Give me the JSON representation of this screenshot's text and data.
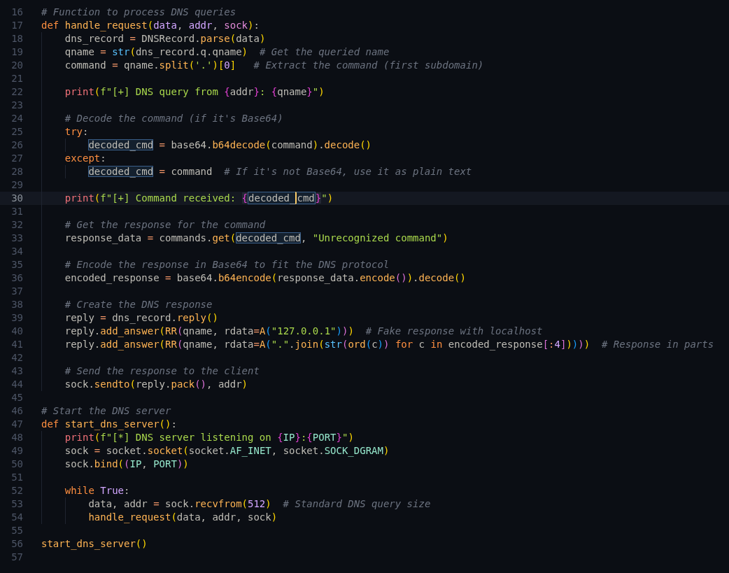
{
  "editor": {
    "lines": [
      {
        "number": "16",
        "current": false,
        "tokens": [
          {
            "text": "# Function to process DNS queries",
            "kind": "comment"
          }
        ]
      },
      {
        "number": "17",
        "current": false,
        "tokens": [
          {
            "text": "def",
            "kind": "kw"
          },
          {
            "text": " handle_request",
            "kind": "fn"
          },
          {
            "text": "(",
            "kind": "p1"
          },
          {
            "text": "data",
            "kind": "param"
          },
          {
            "text": ", ",
            "kind": "punct"
          },
          {
            "text": "addr",
            "kind": "param"
          },
          {
            "text": ", ",
            "kind": "punct"
          },
          {
            "text": "sock",
            "kind": "param2"
          },
          {
            "text": ")",
            "kind": "p1"
          },
          {
            "text": ":",
            "kind": "punct"
          }
        ]
      },
      {
        "number": "18",
        "current": false,
        "tokens": [
          {
            "text": "    dns_record ",
            "kind": "plain"
          },
          {
            "text": "=",
            "kind": "op"
          },
          {
            "text": " DNSRecord.",
            "kind": "plain"
          },
          {
            "text": "parse",
            "kind": "fn"
          },
          {
            "text": "(",
            "kind": "p1"
          },
          {
            "text": "data",
            "kind": "plain"
          },
          {
            "text": ")",
            "kind": "p1"
          }
        ]
      },
      {
        "number": "19",
        "current": false,
        "tokens": [
          {
            "text": "    qname ",
            "kind": "plain"
          },
          {
            "text": "=",
            "kind": "op"
          },
          {
            "text": " str",
            "kind": "builtin"
          },
          {
            "text": "(",
            "kind": "p1"
          },
          {
            "text": "dns_record.q.qname",
            "kind": "plain"
          },
          {
            "text": ")",
            "kind": "p1"
          },
          {
            "text": "  # Get the queried name",
            "kind": "comment"
          }
        ]
      },
      {
        "number": "20",
        "current": false,
        "tokens": [
          {
            "text": "    command ",
            "kind": "plain"
          },
          {
            "text": "=",
            "kind": "op"
          },
          {
            "text": " qname.",
            "kind": "plain"
          },
          {
            "text": "split",
            "kind": "fn"
          },
          {
            "text": "(",
            "kind": "p1"
          },
          {
            "text": "'.'",
            "kind": "str"
          },
          {
            "text": ")",
            "kind": "p1"
          },
          {
            "text": "[",
            "kind": "p1"
          },
          {
            "text": "0",
            "kind": "num"
          },
          {
            "text": "]",
            "kind": "p1"
          },
          {
            "text": "   # Extract the command (first subdomain)",
            "kind": "comment"
          }
        ]
      },
      {
        "number": "21",
        "current": false
      },
      {
        "number": "22",
        "current": false,
        "tokens": [
          {
            "text": "    print",
            "kind": "call"
          },
          {
            "text": "(",
            "kind": "p1"
          },
          {
            "text": "f\"[+] DNS query from ",
            "kind": "str"
          },
          {
            "text": "{",
            "kind": "brace"
          },
          {
            "text": "addr",
            "kind": "plain"
          },
          {
            "text": "}",
            "kind": "brace"
          },
          {
            "text": ": ",
            "kind": "str"
          },
          {
            "text": "{",
            "kind": "brace"
          },
          {
            "text": "qname",
            "kind": "plain"
          },
          {
            "text": "}",
            "kind": "brace"
          },
          {
            "text": "\"",
            "kind": "str"
          },
          {
            "text": ")",
            "kind": "p1"
          }
        ]
      },
      {
        "number": "23",
        "current": false
      },
      {
        "number": "24",
        "current": false,
        "tokens": [
          {
            "text": "    # Decode the command (if it's Base64)",
            "kind": "comment"
          }
        ]
      },
      {
        "number": "25",
        "current": false,
        "tokens": [
          {
            "text": "    try",
            "kind": "kw"
          },
          {
            "text": ":",
            "kind": "punct"
          }
        ]
      },
      {
        "number": "26",
        "current": false,
        "tokens": [
          {
            "text": "        decoded_cmd",
            "kind": "match"
          },
          {
            "text": " =",
            "kind": "op"
          },
          {
            "text": " base64.",
            "kind": "plain"
          },
          {
            "text": "b64decode",
            "kind": "fn"
          },
          {
            "text": "(",
            "kind": "p1"
          },
          {
            "text": "command",
            "kind": "plain"
          },
          {
            "text": ")",
            "kind": "p1"
          },
          {
            "text": ".",
            "kind": "plain"
          },
          {
            "text": "decode",
            "kind": "fn"
          },
          {
            "text": "()",
            "kind": "p1"
          }
        ]
      },
      {
        "number": "27",
        "current": false,
        "tokens": [
          {
            "text": "    except",
            "kind": "kw"
          },
          {
            "text": ":",
            "kind": "punct"
          }
        ]
      },
      {
        "number": "28",
        "current": false,
        "tokens": [
          {
            "text": "        decoded_cmd",
            "kind": "match"
          },
          {
            "text": " =",
            "kind": "op"
          },
          {
            "text": " command",
            "kind": "plain"
          },
          {
            "text": "  # If it's not Base64, use it as plain text",
            "kind": "comment"
          }
        ]
      },
      {
        "number": "29",
        "current": false
      },
      {
        "number": "30",
        "current": true,
        "tokens": [
          {
            "text": "    print",
            "kind": "call"
          },
          {
            "text": "(",
            "kind": "p1"
          },
          {
            "text": "f\"[+] Command received: ",
            "kind": "str"
          },
          {
            "text": "{",
            "kind": "brace-pair"
          },
          {
            "text": "decoded_",
            "kind": "match-left"
          },
          {
            "text": "cmd",
            "kind": "match-right-caret"
          },
          {
            "text": "}",
            "kind": "brace-pair"
          },
          {
            "text": "\"",
            "kind": "str"
          },
          {
            "text": ")",
            "kind": "p1"
          }
        ]
      },
      {
        "number": "31",
        "current": false
      },
      {
        "number": "32",
        "current": false,
        "tokens": [
          {
            "text": "    # Get the response for the command",
            "kind": "comment"
          }
        ]
      },
      {
        "number": "33",
        "current": false,
        "tokens": [
          {
            "text": "    response_data ",
            "kind": "plain"
          },
          {
            "text": "=",
            "kind": "op"
          },
          {
            "text": " commands.",
            "kind": "plain"
          },
          {
            "text": "get",
            "kind": "fn"
          },
          {
            "text": "(",
            "kind": "p1"
          },
          {
            "text": "decoded_cmd",
            "kind": "match"
          },
          {
            "text": ", ",
            "kind": "punct"
          },
          {
            "text": "\"Unrecognized command\"",
            "kind": "str"
          },
          {
            "text": ")",
            "kind": "p1"
          }
        ]
      },
      {
        "number": "34",
        "current": false
      },
      {
        "number": "35",
        "current": false,
        "tokens": [
          {
            "text": "    # Encode the response in Base64 to fit the DNS protocol",
            "kind": "comment"
          }
        ]
      },
      {
        "number": "36",
        "current": false,
        "tokens": [
          {
            "text": "    encoded_response ",
            "kind": "plain"
          },
          {
            "text": "=",
            "kind": "op"
          },
          {
            "text": " base64.",
            "kind": "plain"
          },
          {
            "text": "b64encode",
            "kind": "fn"
          },
          {
            "text": "(",
            "kind": "p1"
          },
          {
            "text": "response_data.",
            "kind": "plain"
          },
          {
            "text": "encode",
            "kind": "fn"
          },
          {
            "text": "()",
            "kind": "p2"
          },
          {
            "text": ")",
            "kind": "p1"
          },
          {
            "text": ".",
            "kind": "plain"
          },
          {
            "text": "decode",
            "kind": "fn"
          },
          {
            "text": "()",
            "kind": "p1"
          }
        ]
      },
      {
        "number": "37",
        "current": false
      },
      {
        "number": "38",
        "current": false,
        "tokens": [
          {
            "text": "    # Create the DNS response",
            "kind": "comment"
          }
        ]
      },
      {
        "number": "39",
        "current": false,
        "tokens": [
          {
            "text": "    reply ",
            "kind": "plain"
          },
          {
            "text": "=",
            "kind": "op"
          },
          {
            "text": " dns_record.",
            "kind": "plain"
          },
          {
            "text": "reply",
            "kind": "fn"
          },
          {
            "text": "()",
            "kind": "p1"
          }
        ]
      },
      {
        "number": "40",
        "current": false,
        "tokens": [
          {
            "text": "    reply.",
            "kind": "plain"
          },
          {
            "text": "add_answer",
            "kind": "fn"
          },
          {
            "text": "(",
            "kind": "p1"
          },
          {
            "text": "RR",
            "kind": "fn"
          },
          {
            "text": "(",
            "kind": "p2"
          },
          {
            "text": "qname, rdata",
            "kind": "plain"
          },
          {
            "text": "=",
            "kind": "op"
          },
          {
            "text": "A",
            "kind": "fn"
          },
          {
            "text": "(",
            "kind": "p3"
          },
          {
            "text": "\"127.0.0.1\"",
            "kind": "str"
          },
          {
            "text": ")",
            "kind": "p3"
          },
          {
            "text": ")",
            "kind": "p2"
          },
          {
            "text": ")",
            "kind": "p1"
          },
          {
            "text": "  # Fake response with localhost",
            "kind": "comment"
          }
        ]
      },
      {
        "number": "41",
        "current": false,
        "tokens": [
          {
            "text": "    reply.",
            "kind": "plain"
          },
          {
            "text": "add_answer",
            "kind": "fn"
          },
          {
            "text": "(",
            "kind": "p1"
          },
          {
            "text": "RR",
            "kind": "fn"
          },
          {
            "text": "(",
            "kind": "p2"
          },
          {
            "text": "qname, rdata",
            "kind": "plain"
          },
          {
            "text": "=",
            "kind": "op"
          },
          {
            "text": "A",
            "kind": "fn"
          },
          {
            "text": "(",
            "kind": "p3"
          },
          {
            "text": "\".\"",
            "kind": "str"
          },
          {
            "text": ".",
            "kind": "plain"
          },
          {
            "text": "join",
            "kind": "fn"
          },
          {
            "text": "(",
            "kind": "p1"
          },
          {
            "text": "str",
            "kind": "builtin"
          },
          {
            "text": "(",
            "kind": "p2"
          },
          {
            "text": "ord",
            "kind": "fn"
          },
          {
            "text": "(",
            "kind": "p3"
          },
          {
            "text": "c",
            "kind": "plain"
          },
          {
            "text": ")",
            "kind": "p3"
          },
          {
            "text": ")",
            "kind": "p2"
          },
          {
            "text": " for",
            "kind": "kw"
          },
          {
            "text": " c",
            "kind": "plain"
          },
          {
            "text": " in",
            "kind": "kw"
          },
          {
            "text": " encoded_response",
            "kind": "plain"
          },
          {
            "text": "[",
            "kind": "p2"
          },
          {
            "text": ":",
            "kind": "op"
          },
          {
            "text": "4",
            "kind": "num"
          },
          {
            "text": "]",
            "kind": "p2"
          },
          {
            "text": ")",
            "kind": "p1"
          },
          {
            "text": ")",
            "kind": "p3"
          },
          {
            "text": ")",
            "kind": "p2"
          },
          {
            "text": ")",
            "kind": "p1"
          },
          {
            "text": "  # Response in parts",
            "kind": "comment"
          }
        ]
      },
      {
        "number": "42",
        "current": false
      },
      {
        "number": "43",
        "current": false,
        "tokens": [
          {
            "text": "    # Send the response to the client",
            "kind": "comment"
          }
        ]
      },
      {
        "number": "44",
        "current": false,
        "tokens": [
          {
            "text": "    sock.",
            "kind": "plain"
          },
          {
            "text": "sendto",
            "kind": "fn"
          },
          {
            "text": "(",
            "kind": "p1"
          },
          {
            "text": "reply.",
            "kind": "plain"
          },
          {
            "text": "pack",
            "kind": "fn"
          },
          {
            "text": "()",
            "kind": "p2"
          },
          {
            "text": ", ",
            "kind": "punct"
          },
          {
            "text": "addr",
            "kind": "plain"
          },
          {
            "text": ")",
            "kind": "p1"
          }
        ]
      },
      {
        "number": "45",
        "current": false
      },
      {
        "number": "46",
        "current": false,
        "tokens": [
          {
            "text": "# Start the DNS server",
            "kind": "comment"
          }
        ]
      },
      {
        "number": "47",
        "current": false,
        "tokens": [
          {
            "text": "def",
            "kind": "kw"
          },
          {
            "text": " start_dns_server",
            "kind": "fn"
          },
          {
            "text": "()",
            "kind": "p1"
          },
          {
            "text": ":",
            "kind": "punct"
          }
        ]
      },
      {
        "number": "48",
        "current": false,
        "tokens": [
          {
            "text": "    print",
            "kind": "call"
          },
          {
            "text": "(",
            "kind": "p1"
          },
          {
            "text": "f\"[*] DNS server listening on ",
            "kind": "str"
          },
          {
            "text": "{",
            "kind": "brace"
          },
          {
            "text": "IP",
            "kind": "attr"
          },
          {
            "text": "}",
            "kind": "brace"
          },
          {
            "text": ":",
            "kind": "str"
          },
          {
            "text": "{",
            "kind": "brace"
          },
          {
            "text": "PORT",
            "kind": "attr"
          },
          {
            "text": "}",
            "kind": "brace"
          },
          {
            "text": "\"",
            "kind": "str"
          },
          {
            "text": ")",
            "kind": "p1"
          }
        ]
      },
      {
        "number": "49",
        "current": false,
        "tokens": [
          {
            "text": "    sock ",
            "kind": "plain"
          },
          {
            "text": "=",
            "kind": "op"
          },
          {
            "text": " socket.",
            "kind": "plain"
          },
          {
            "text": "socket",
            "kind": "fn"
          },
          {
            "text": "(",
            "kind": "p1"
          },
          {
            "text": "socket.",
            "kind": "plain"
          },
          {
            "text": "AF_INET",
            "kind": "attr"
          },
          {
            "text": ", ",
            "kind": "punct"
          },
          {
            "text": "socket.",
            "kind": "plain"
          },
          {
            "text": "SOCK_DGRAM",
            "kind": "attr"
          },
          {
            "text": ")",
            "kind": "p1"
          }
        ]
      },
      {
        "number": "50",
        "current": false,
        "tokens": [
          {
            "text": "    sock.",
            "kind": "plain"
          },
          {
            "text": "bind",
            "kind": "fn"
          },
          {
            "text": "(",
            "kind": "p1"
          },
          {
            "text": "(",
            "kind": "p2"
          },
          {
            "text": "IP",
            "kind": "attr"
          },
          {
            "text": ", ",
            "kind": "punct"
          },
          {
            "text": "PORT",
            "kind": "attr"
          },
          {
            "text": ")",
            "kind": "p2"
          },
          {
            "text": ")",
            "kind": "p1"
          }
        ]
      },
      {
        "number": "51",
        "current": false
      },
      {
        "number": "52",
        "current": false,
        "tokens": [
          {
            "text": "    while",
            "kind": "kw"
          },
          {
            "text": " True",
            "kind": "const"
          },
          {
            "text": ":",
            "kind": "punct"
          }
        ]
      },
      {
        "number": "53",
        "current": false,
        "tokens": [
          {
            "text": "        data, addr ",
            "kind": "plain"
          },
          {
            "text": "=",
            "kind": "op"
          },
          {
            "text": " sock.",
            "kind": "plain"
          },
          {
            "text": "recvfrom",
            "kind": "fn"
          },
          {
            "text": "(",
            "kind": "p1"
          },
          {
            "text": "512",
            "kind": "num"
          },
          {
            "text": ")",
            "kind": "p1"
          },
          {
            "text": "  # Standard DNS query size",
            "kind": "comment"
          }
        ]
      },
      {
        "number": "54",
        "current": false,
        "tokens": [
          {
            "text": "        handle_request",
            "kind": "fn"
          },
          {
            "text": "(",
            "kind": "p1"
          },
          {
            "text": "data, addr, sock",
            "kind": "plain"
          },
          {
            "text": ")",
            "kind": "p1"
          }
        ]
      },
      {
        "number": "55",
        "current": false
      },
      {
        "number": "56",
        "current": false,
        "tokens": [
          {
            "text": "start_dns_server",
            "kind": "fn"
          },
          {
            "text": "()",
            "kind": "p1"
          }
        ]
      },
      {
        "number": "57",
        "current": false
      }
    ]
  }
}
